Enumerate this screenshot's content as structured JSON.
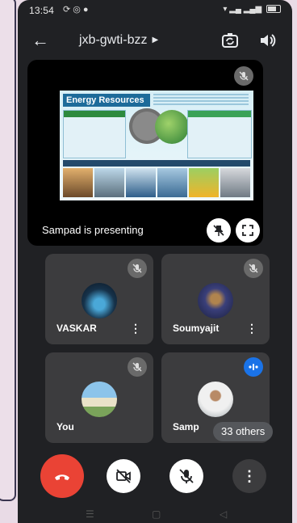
{
  "status_bar": {
    "time": "13:54"
  },
  "top_bar": {
    "meeting_code": "jxb-gwti-bzz"
  },
  "presentation": {
    "slide_title": "Energy Resources",
    "presenter_label": "Sampad is presenting"
  },
  "participants": [
    {
      "name": "VASKAR"
    },
    {
      "name": "Soumyajit"
    },
    {
      "name": "You"
    },
    {
      "name": "Samp",
      "others_label": "33 others"
    }
  ],
  "colors": {
    "background": "#202124",
    "tile": "#3c3c3e",
    "end_call": "#ea4335",
    "speaking": "#1a73e8"
  },
  "icons": [
    "back-arrow-icon",
    "switch-camera-icon",
    "speaker-icon",
    "mic-off-icon",
    "pin-off-icon",
    "fullscreen-icon",
    "more-vert-icon",
    "end-call-icon",
    "camera-off-icon",
    "speaking-indicator-icon"
  ]
}
